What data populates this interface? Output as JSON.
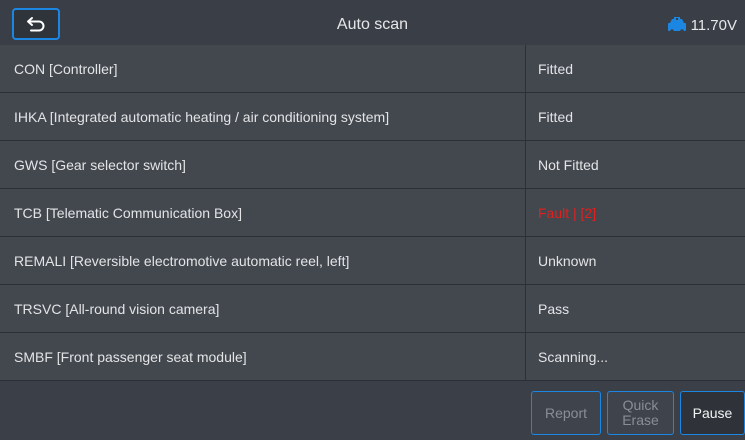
{
  "header": {
    "title": "Auto scan",
    "voltage": "11.70V"
  },
  "rows": [
    {
      "name": "CON [Controller]",
      "status": "Fitted"
    },
    {
      "name": "IHKA [Integrated automatic heating / air conditioning system]",
      "status": "Fitted"
    },
    {
      "name": "GWS [Gear selector switch]",
      "status": "Not Fitted"
    },
    {
      "name": "TCB [Telematic Communication Box]",
      "status": "Fault | [2]"
    },
    {
      "name": "REMALI [Reversible electromotive automatic reel, left]",
      "status": "Unknown"
    },
    {
      "name": "TRSVC [All-round vision camera]",
      "status": "Pass"
    },
    {
      "name": "SMBF [Front passenger seat module]",
      "status": "Scanning..."
    }
  ],
  "footer": {
    "report_label": "Report",
    "erase_line1": "Quick",
    "erase_line2": "Erase",
    "pause_label": "Pause"
  },
  "colors": {
    "accent": "#1c86e3",
    "fault": "#e0201e",
    "battery_icon": "#1c86e3"
  },
  "icons": {
    "back": "back-arrow-icon",
    "battery": "car-battery-icon"
  }
}
